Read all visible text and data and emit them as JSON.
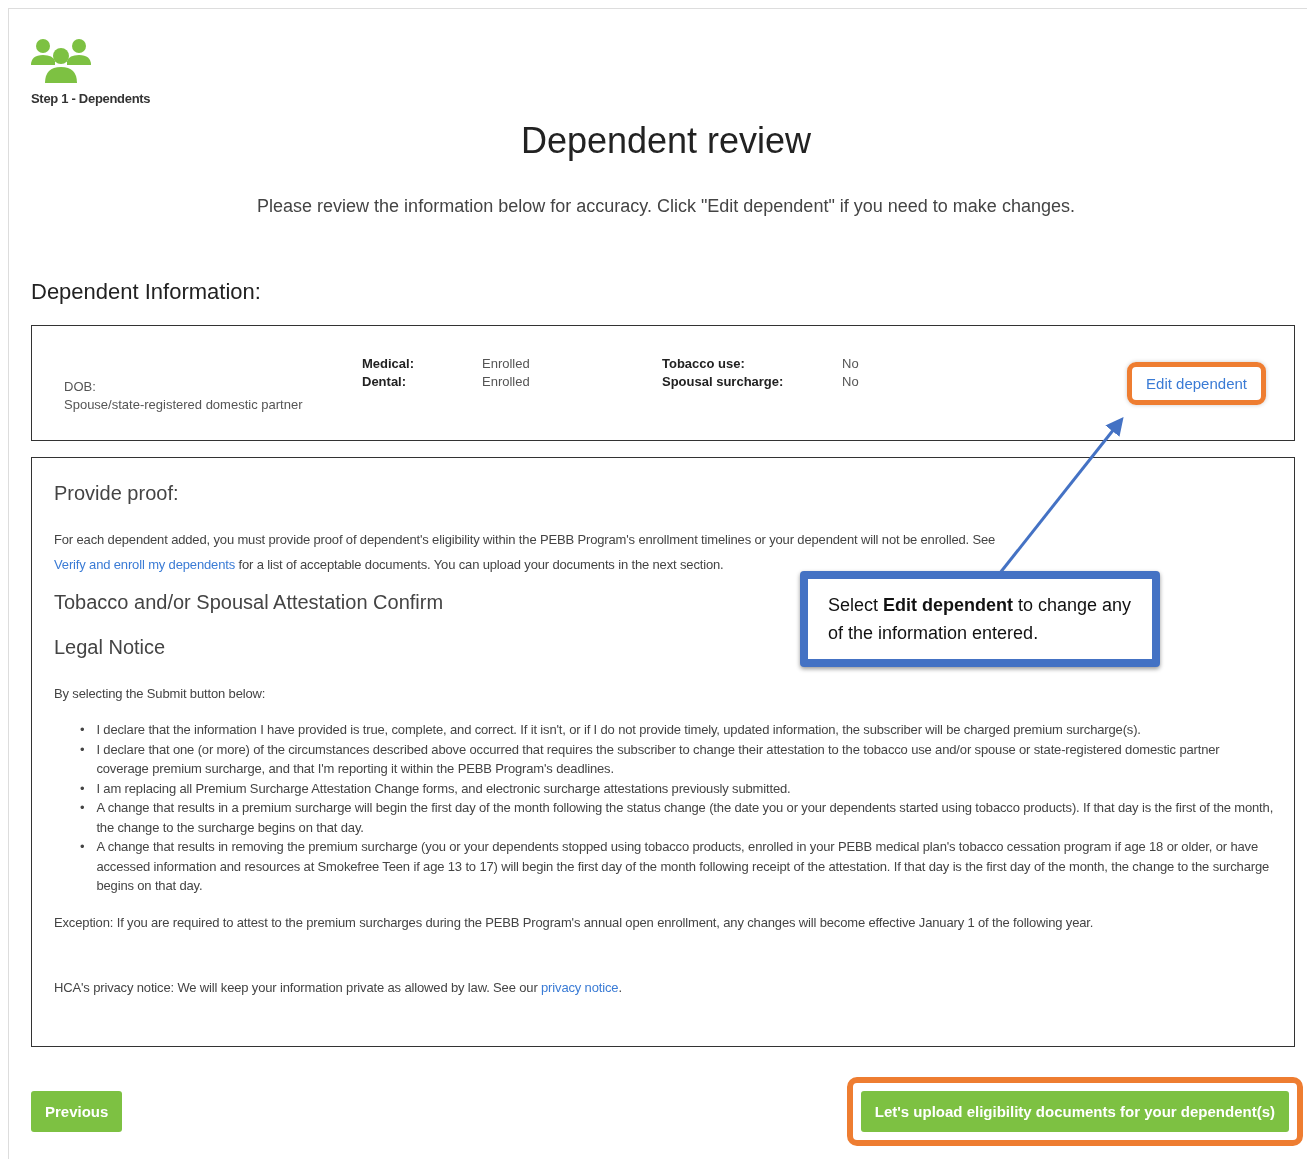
{
  "step": {
    "label": "Step 1 - Dependents"
  },
  "title": "Dependent review",
  "intro": "Please review the information below for accuracy. Click \"Edit dependent\" if you need to make changes.",
  "section_heading": "Dependent Information:",
  "dependent": {
    "dob_label": "DOB:",
    "relationship": "Spouse/state-registered domestic partner",
    "coverage": [
      {
        "label": "Medical:",
        "value": "Enrolled"
      },
      {
        "label": "Dental:",
        "value": "Enrolled"
      }
    ],
    "surcharges": [
      {
        "label": "Tobacco use:",
        "value": "No"
      },
      {
        "label": "Spousal surcharge:",
        "value": "No"
      }
    ],
    "edit_link": {
      "label": "Edit dependent",
      "highlighted": true
    }
  },
  "proof": {
    "heading": "Provide proof:",
    "text_before": "For each dependent added, you must provide proof of dependent's eligibility within the PEBB Program's enrollment timelines or your dependent will not be enrolled. See ",
    "link": "Verify and enroll my dependents",
    "text_after": " for a list of acceptable documents. You can upload your documents in the next section.",
    "attestation_heading": "Tobacco and/or Spousal Attestation Confirm",
    "legal_heading": "Legal Notice",
    "legal_intro": "By selecting the Submit button below:",
    "items": [
      {
        "marker": "•",
        "text": "I declare that the information I have provided is true, complete, and correct. If it isn't, or if I do not provide timely, updated information, the subscriber will be charged premium surcharge(s)."
      },
      {
        "marker": "•",
        "text": "I declare that one (or more) of the circumstances described above occurred that requires the subscriber to change their attestation to the tobacco use and/or spouse or state-registered domestic partner coverage premium surcharge, and that I'm reporting it within the PEBB Program's deadlines."
      },
      {
        "marker": "•",
        "text": "I am replacing all Premium Surcharge Attestation Change forms, and electronic surcharge attestations previously submitted."
      },
      {
        "marker": "•",
        "text": "A change that results in a premium surcharge will begin the first day of the month following the status change (the date you or your dependents started using tobacco products). If that day is the first of the month, the change to the surcharge begins on that day."
      },
      {
        "marker": "•",
        "text": "A change that results in removing the premium surcharge (you or your dependents stopped using tobacco products, enrolled in your PEBB medical plan's tobacco cessation program if age 18 or older, or have accessed information and resources at Smokefree Teen if age 13 to 17) will begin the first day of the month following receipt of the attestation. If that day is the first day of the month, the change to the surcharge begins on that day."
      }
    ],
    "exception": "Exception: If you are required to attest to the premium surcharges during the PEBB Program's annual open enrollment, any changes will become effective January 1 of the following year.",
    "privacy_before": "HCA's privacy notice: We will keep your information private as allowed by law. See our ",
    "privacy_link": "privacy notice",
    "privacy_after": "."
  },
  "callout": {
    "text": "Select **Edit dependent** to change any of the information entered."
  },
  "buttons": {
    "previous": "Previous",
    "next": {
      "label": "Let's upload eligibility documents for your dependent(s)",
      "highlighted": true
    }
  }
}
